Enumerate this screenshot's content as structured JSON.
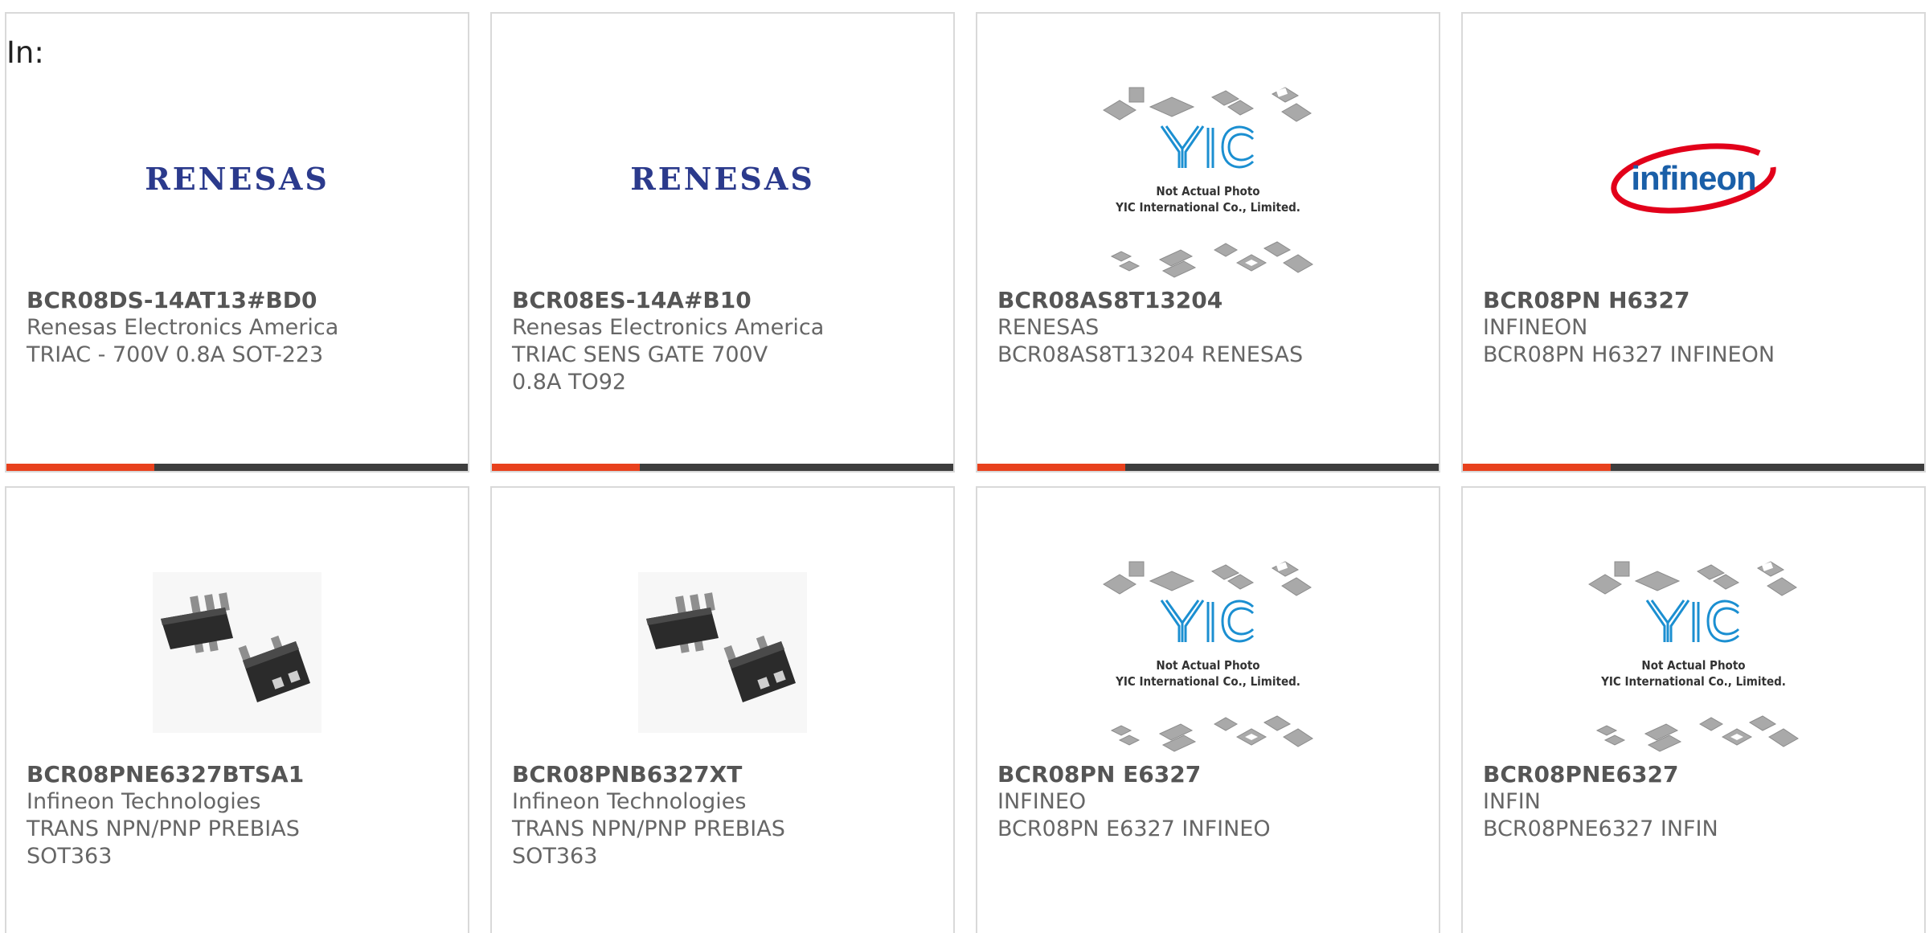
{
  "header": {
    "in_label": "In:"
  },
  "colors": {
    "accent": "#e8411d",
    "bar_rest": "#3d3d3d",
    "renesas_blue": "#2b3a8c",
    "infineon_red": "#e2001a",
    "infineon_blue": "#1a5fa8",
    "yic_blue": "#1b8fd1"
  },
  "cards": [
    {
      "part": "BCR08DS-14AT13#BD0",
      "manufacturer": "Renesas Electronics America",
      "description": "TRIAC - 700V 0.8A SOT-223",
      "image": "renesas-logo",
      "logo_text": "RENESAS"
    },
    {
      "part": "BCR08ES-14A#B10",
      "manufacturer": "Renesas Electronics America",
      "description": "TRIAC SENS GATE 700V 0.8A TO92",
      "image": "renesas-logo",
      "logo_text": "RENESAS"
    },
    {
      "part": "BCR08AS8T13204",
      "manufacturer": "RENESAS",
      "description": "BCR08AS8T13204 RENESAS",
      "image": "yic-placeholder",
      "placeholder_line1": "Not Actual Photo",
      "placeholder_line2": "YIC International Co., Limited."
    },
    {
      "part": "BCR08PN H6327",
      "manufacturer": "INFINEON",
      "description": "BCR08PN H6327 INFINEON",
      "image": "infineon-logo",
      "logo_text": "infineon"
    },
    {
      "part": "BCR08PNE6327BTSA1",
      "manufacturer": "Infineon Technologies",
      "description": "TRANS NPN/PNP PREBIAS SOT363",
      "image": "chip-photo"
    },
    {
      "part": "BCR08PNB6327XT",
      "manufacturer": "Infineon Technologies",
      "description": "TRANS NPN/PNP PREBIAS SOT363",
      "image": "chip-photo"
    },
    {
      "part": "BCR08PN E6327",
      "manufacturer": "INFINEO",
      "description": "BCR08PN E6327 INFINEO",
      "image": "yic-placeholder",
      "placeholder_line1": "Not Actual Photo",
      "placeholder_line2": "YIC International Co., Limited."
    },
    {
      "part": "BCR08PNE6327",
      "manufacturer": "INFIN",
      "description": "BCR08PNE6327 INFIN",
      "image": "yic-placeholder",
      "placeholder_line1": "Not Actual Photo",
      "placeholder_line2": "YIC International Co., Limited."
    }
  ]
}
